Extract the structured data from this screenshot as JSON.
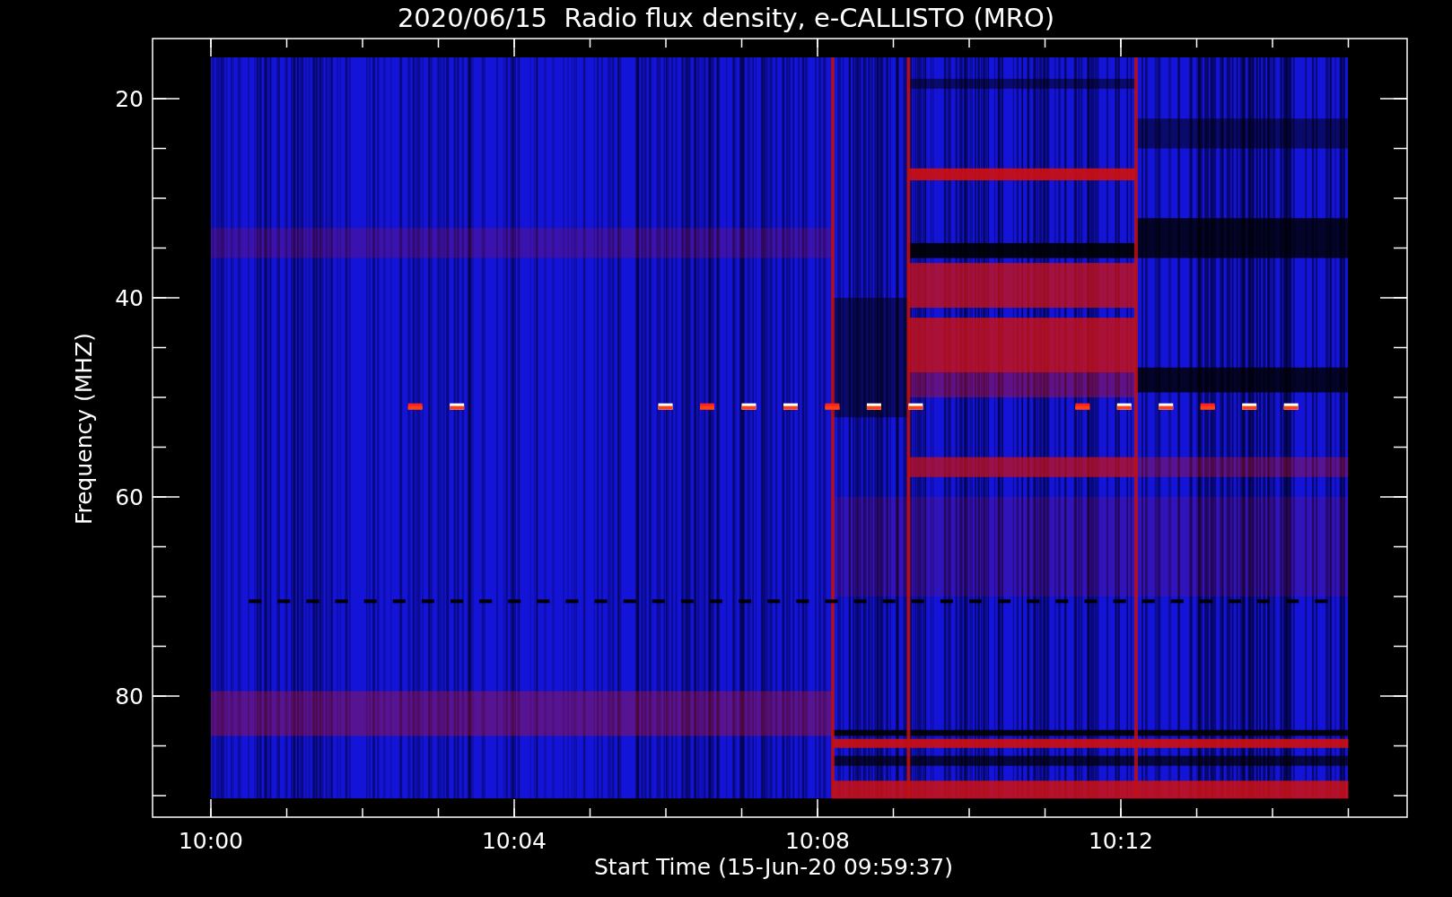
{
  "title": "2020/06/15  Radio flux density, e-CALLISTO (MRO)",
  "x_axis": {
    "label": "Start Time (15-Jun-20 09:59:37)",
    "ticks": [
      "10:00",
      "10:04",
      "10:08",
      "10:12"
    ]
  },
  "y_axis": {
    "label": "Frequency (MHZ)",
    "ticks": [
      "20",
      "40",
      "60",
      "80"
    ]
  }
}
